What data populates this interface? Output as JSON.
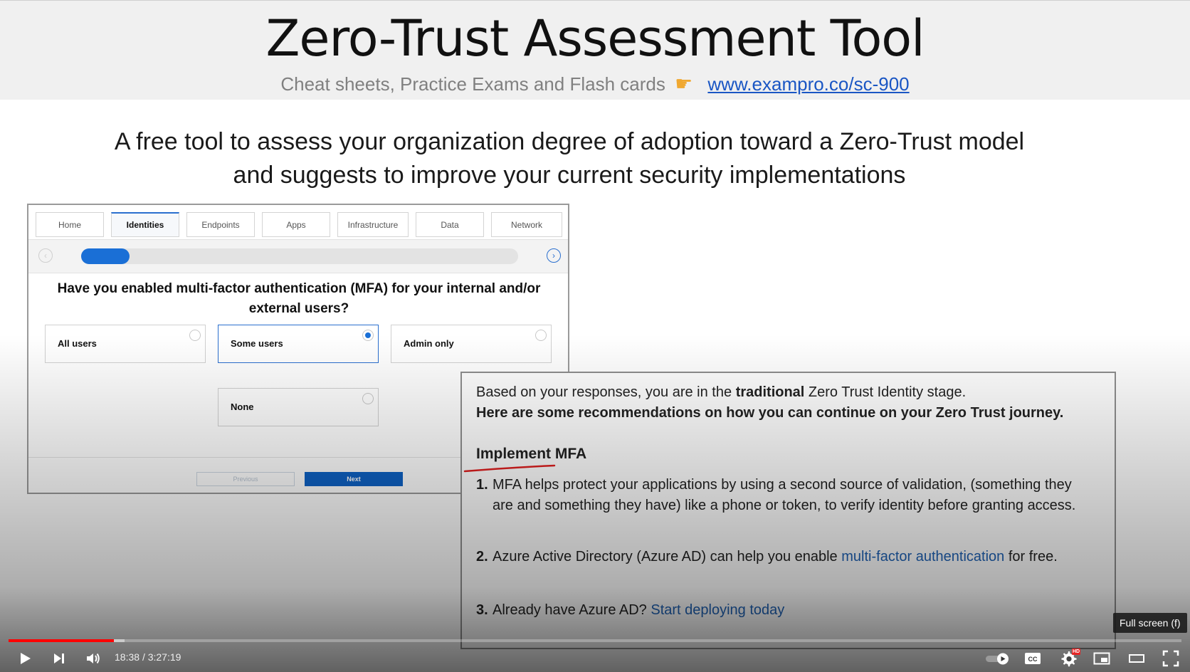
{
  "slide": {
    "title": "Zero-Trust Assessment Tool",
    "subtitle": "Cheat sheets, Practice Exams and Flash cards",
    "subtitle_link": "www.exampro.co/sc-900",
    "description_line1": "A free tool to assess your organization degree of adoption toward a Zero-Trust model",
    "description_line2": "and suggests to improve your current security implementations"
  },
  "tool": {
    "tabs": [
      {
        "label": "Home"
      },
      {
        "label": "Identities",
        "active": true
      },
      {
        "label": "Endpoints"
      },
      {
        "label": "Apps"
      },
      {
        "label": "Infrastructure"
      },
      {
        "label": "Data"
      },
      {
        "label": "Network"
      }
    ],
    "progress_fraction": 0.11,
    "question": "Have you enabled multi-factor authentication (MFA) for your internal and/or external users?",
    "options": [
      {
        "label": "All users",
        "selected": false
      },
      {
        "label": "Some users",
        "selected": true
      },
      {
        "label": "Admin only",
        "selected": false
      },
      {
        "label": "None",
        "selected": false
      }
    ],
    "previous_label": "Previous",
    "next_label": "Next"
  },
  "recommendations": {
    "intro_prefix": "Based on your responses, you are in the",
    "intro_bold": "traditional",
    "intro_suffix": "Zero Trust Identity stage.",
    "intro_line2": "Here are some recommendations on how you can continue on your Zero Trust journey.",
    "heading": "Implement MFA",
    "items": [
      {
        "num": "1.",
        "text": "MFA helps protect your applications by using a second source of validation, (something they are and something they have) like a phone or token, to verify identity before granting access."
      },
      {
        "num": "2.",
        "text_before": "Azure Active Directory (Azure AD) can help you enable",
        "link": "multi-factor authentication",
        "text_after": "for free."
      },
      {
        "num": "3.",
        "text_before": "Already have Azure AD?",
        "link": "Start deploying today"
      }
    ]
  },
  "player": {
    "current_time": "18:38",
    "separator": "/",
    "duration": "3:27:19",
    "played_fraction": 0.0897,
    "buffered_fraction": 0.099,
    "tooltip": "Full screen (f)",
    "hd_badge": "HD",
    "cc_label": "CC",
    "icons": [
      "play-icon",
      "next-icon",
      "volume-icon",
      "autoplay-toggle-icon",
      "cc-icon",
      "settings-gear-icon",
      "miniplayer-icon",
      "theater-mode-icon",
      "fullscreen-icon"
    ]
  },
  "colors": {
    "accent_blue": "#1a6fd6",
    "link_blue": "#1f62b5",
    "progress_red": "#ff0000",
    "highlight_red": "#e02020"
  }
}
